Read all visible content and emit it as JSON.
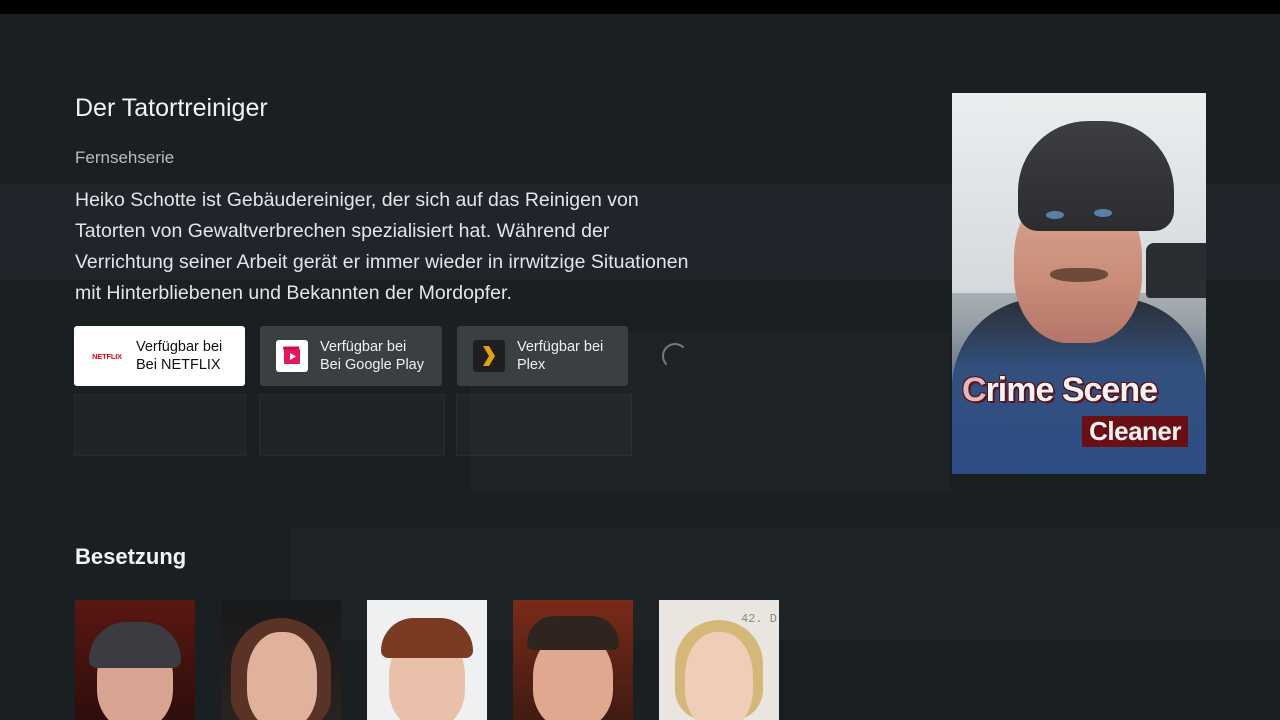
{
  "show": {
    "title": "Der Tatortreiniger",
    "type": "Fernsehserie",
    "description": "Heiko Schotte ist Gebäudereiniger, der sich auf das Reinigen von Tatorten von Gewaltverbrechen spezialisiert hat. Während der Verrichtung seiner Arbeit gerät er immer wieder in irrwitzige Situationen mit Hinterbliebenen und Bekannten der Mordopfer."
  },
  "providers": [
    {
      "line1": "Verfügbar bei",
      "line2": "Bei NETFLIX",
      "icon": "netflix-icon",
      "logo_text": "NETFLIX",
      "focused": true
    },
    {
      "line1": "Verfügbar bei",
      "line2": "Bei Google Play",
      "icon": "google-play-movies-icon",
      "focused": false
    },
    {
      "line1": "Verfügbar bei",
      "line2": "Plex",
      "icon": "plex-icon",
      "focused": false
    }
  ],
  "poster": {
    "title_line1_first": "C",
    "title_line1_rest": "rime Scene",
    "title_line2": "Cleaner"
  },
  "cast": {
    "heading": "Besetzung",
    "members": [
      {
        "id": "cast-1"
      },
      {
        "id": "cast-2"
      },
      {
        "id": "cast-3"
      },
      {
        "id": "cast-4"
      },
      {
        "id": "cast-5",
        "sign_text": "42. D"
      }
    ]
  },
  "colors": {
    "background": "#1a1f21",
    "provider_bg": "#3a3f42",
    "provider_focused_bg": "#ffffff",
    "netflix_red": "#e50914",
    "plex_yellow": "#e5a00d"
  }
}
